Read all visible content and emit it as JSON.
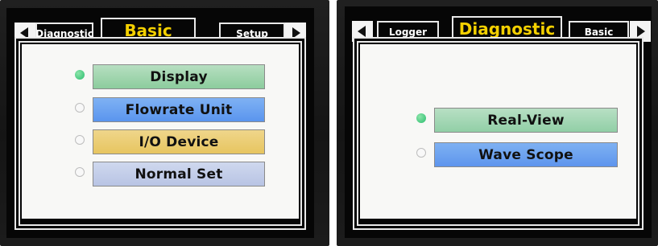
{
  "left_screen": {
    "tabs": {
      "previous": "Diagnostic",
      "current": "Basic",
      "next": "Setup"
    },
    "menu": [
      {
        "label": "Display",
        "selected": true,
        "color": "#a7d8b6"
      },
      {
        "label": "Flowrate Unit",
        "selected": false,
        "color": "#6fa6f1"
      },
      {
        "label": "I/O Device",
        "selected": false,
        "color": "#ebd175"
      },
      {
        "label": "Normal Set",
        "selected": false,
        "color": "#c3cde9"
      }
    ]
  },
  "right_screen": {
    "tabs": {
      "previous": "Logger",
      "current": "Diagnostic",
      "next": "Basic"
    },
    "menu": [
      {
        "label": "Real-View",
        "selected": true,
        "color": "#a8d9b8"
      },
      {
        "label": "Wave Scope",
        "selected": false,
        "color": "#6ea5f0"
      }
    ]
  },
  "colors": {
    "active_tab_text": "#f4d000",
    "tab_text": "#ffffff",
    "screen_background": "#f8f8f6",
    "selected_radio": "#47c980"
  },
  "icons": {
    "left": "left-arrow-icon",
    "right": "right-arrow-icon"
  }
}
